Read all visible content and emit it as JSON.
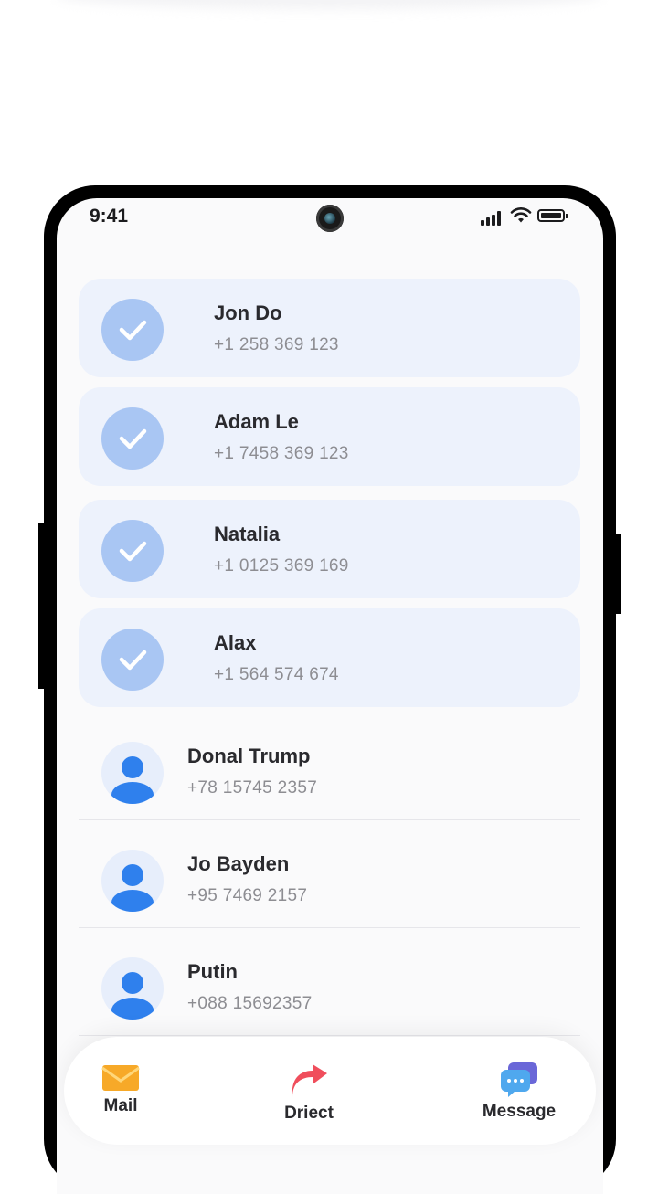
{
  "status_bar": {
    "time": "9:41"
  },
  "contacts": [
    {
      "name": "Jon Do",
      "phone": "+1 258 369 123",
      "selected": true
    },
    {
      "name": "Adam Le",
      "phone": "+1 7458 369 123",
      "selected": true
    },
    {
      "name": "Natalia",
      "phone": "+1 0125 369 169",
      "selected": true
    },
    {
      "name": "Alax",
      "phone": "+1 564 574 674",
      "selected": true
    },
    {
      "name": "Donal Trump",
      "phone": "+78 15745 2357",
      "selected": false
    },
    {
      "name": "Jo Bayden",
      "phone": "+95 7469 2157",
      "selected": false
    },
    {
      "name": "Putin",
      "phone": "+088 15692357",
      "selected": false
    }
  ],
  "bottom_nav": {
    "mail_label": "Mail",
    "direct_label": "Driect",
    "message_label": "Message"
  },
  "colors": {
    "selected_row": "#edf2fc",
    "check_circle": "#a9c6f3",
    "avatar_blue": "#2f80ed",
    "direct_red": "#f04e5c",
    "mail_orange": "#f7a928"
  }
}
